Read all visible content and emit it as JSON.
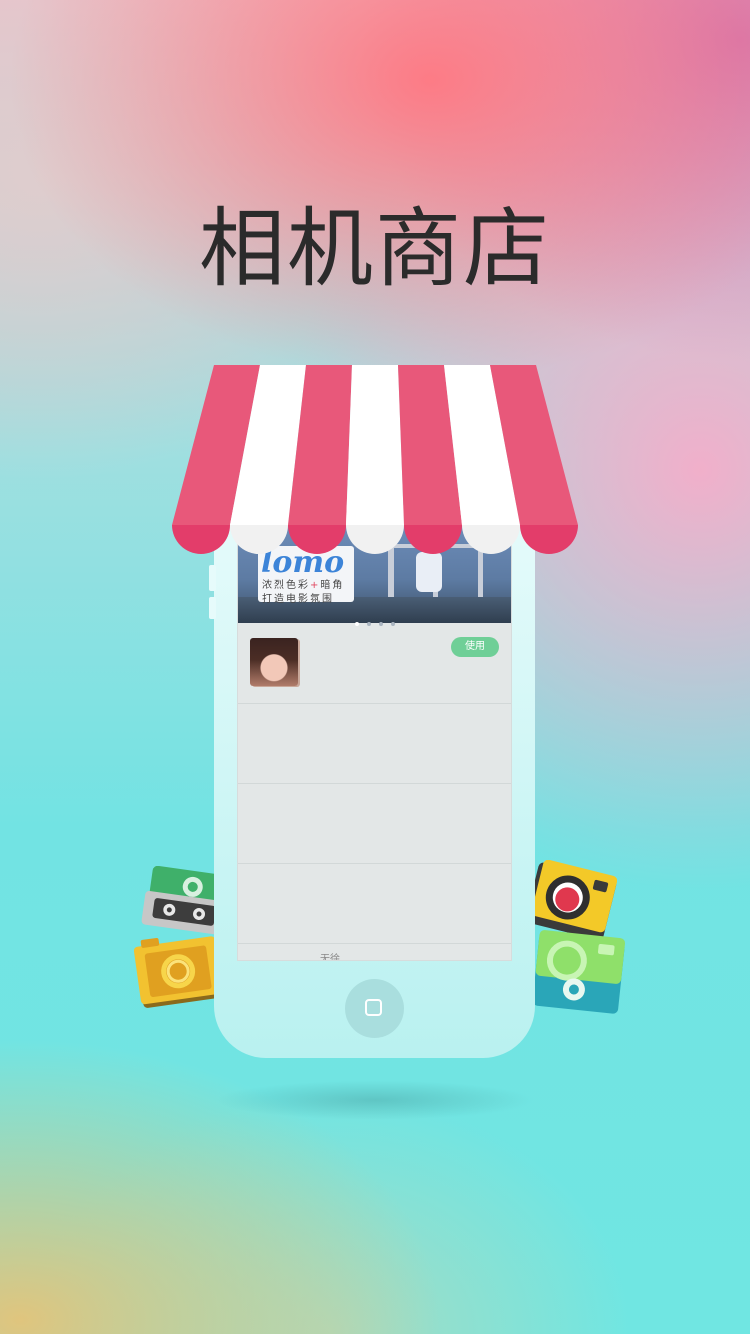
{
  "title": "相机商店",
  "colors": {
    "awning_red": "#e8587a",
    "awning_scallop": "#e33d6a",
    "awning_white": "#ffffff",
    "phone_body": "#cdf6f5",
    "use_button": "#6fcf97"
  },
  "banner": {
    "logo_text": "lomo",
    "line1_a": "浓烈色彩",
    "line1_plus": "+",
    "line1_b": "暗角",
    "line2": "打造电影氛围",
    "page_count": 4,
    "active_page": 1
  },
  "list": {
    "items": [
      {
        "action_label": "使用"
      },
      {},
      {},
      {
        "partial_text": "无徐"
      }
    ]
  },
  "icons": {
    "left_top": "cassette-camera-icon",
    "left_bottom": "yellow-camera-icon",
    "right_top": "yellow-polaroid-icon",
    "right_bottom": "green-camera-icon",
    "home": "home-button-icon"
  }
}
